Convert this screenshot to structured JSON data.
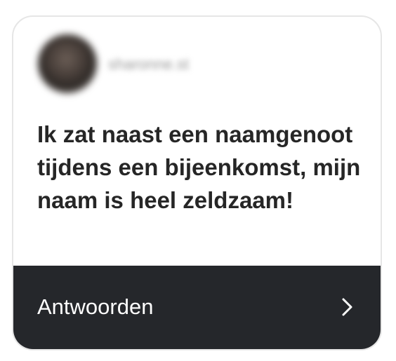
{
  "card": {
    "username": "sharonne.st",
    "question": "Ik zat naast een naamgenoot tijdens een bijeenkomst, mijn naam is heel zeldzaam!",
    "reply_label": "Antwoorden"
  },
  "icons": {
    "reply": "chevron-right-icon"
  },
  "colors": {
    "footer_background": "#25272b",
    "question_text": "#262626",
    "card_border": "#e6e6e6"
  }
}
